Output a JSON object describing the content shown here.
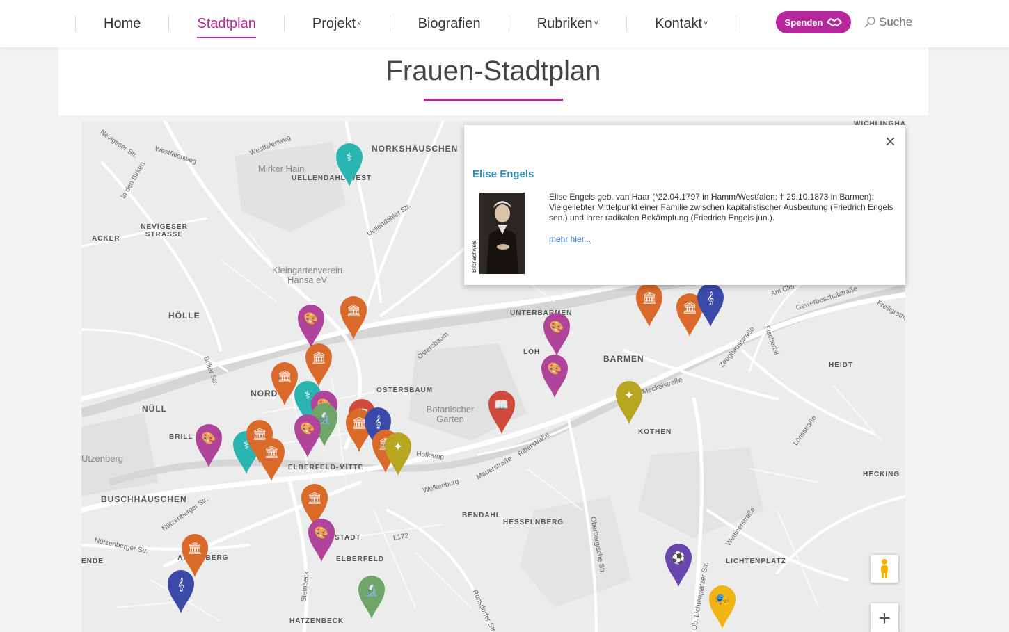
{
  "nav": {
    "items": [
      {
        "label": "Home",
        "active": false,
        "dropdown": false
      },
      {
        "label": "Stadtplan",
        "active": true,
        "dropdown": false
      },
      {
        "label": "Projekt",
        "active": false,
        "dropdown": true
      },
      {
        "label": "Biografien",
        "active": false,
        "dropdown": false
      },
      {
        "label": "Rubriken",
        "active": false,
        "dropdown": true
      },
      {
        "label": "Kontakt",
        "active": false,
        "dropdown": true
      }
    ],
    "donate_label": "Spenden",
    "search_label": "Suche"
  },
  "page": {
    "title": "Frauen-Stadtplan"
  },
  "map": {
    "place_labels": [
      "NORKSHÄUSCHEN",
      "UELLENDAHL-WEST",
      "Mirker Hain",
      "NEVIGESER STRASSE",
      "ACKER",
      "Kleingartenverein Hansa eV",
      "HÖLLE",
      "NÜLL",
      "BRILL",
      "NORD",
      "OSTERSBAUM",
      "Botanischer Garten",
      "UNTERBARMEN",
      "LOH",
      "BARMEN",
      "HEIDT",
      "KOTHEN",
      "BUSCHHÄUSCHEN",
      "ELBERFELD-MITTE",
      "STADT",
      "ELBERFELD",
      "BENDAHL",
      "HESSELNBERG",
      "LICHTENPLATZ",
      "HECKING",
      "WICHLINGHAU",
      "HATZENBECK",
      "ENDE",
      "Utzenberg",
      "ARRENBERG"
    ],
    "street_labels": [
      "Nevigeser Str.",
      "Westfalenweg",
      "Uellendahler Str.",
      "Briller Str.",
      "Hofkamp",
      "Wolkenburg",
      "Mauerstraße",
      "Ritterstraße",
      "Meckelstraße",
      "Zeughausstraße",
      "Fischertal",
      "Lönsstraße",
      "Nützenberger Str.",
      "Steinbeck",
      "L172",
      "Oberbergische Str.",
      "Wettinerstraße",
      "Ob. Lichtenplatzer Str.",
      "Am Clef",
      "Gewerbeschulstraße",
      "Freiligrathstr.",
      "Ronsdorfer Str.",
      "Ostersbaum",
      "In den Birken"
    ],
    "pins": [
      {
        "category": "medicine",
        "color": "#2ab5b3",
        "icon": "stethoscope-icon"
      },
      {
        "category": "art",
        "color": "#b0449a",
        "icon": "palette-icon"
      },
      {
        "category": "history",
        "color": "#d96a2a",
        "icon": "museum-icon"
      },
      {
        "category": "history",
        "color": "#d96a2a",
        "icon": "museum-icon"
      },
      {
        "category": "history",
        "color": "#d96a2a",
        "icon": "museum-icon"
      },
      {
        "category": "medicine",
        "color": "#2ab5b3",
        "icon": "stethoscope-icon"
      },
      {
        "category": "art",
        "color": "#b0449a",
        "icon": "palette-icon"
      },
      {
        "category": "science",
        "color": "#6ea66a",
        "icon": "microscope-icon"
      },
      {
        "category": "art",
        "color": "#b0449a",
        "icon": "palette-icon"
      },
      {
        "category": "literature",
        "color": "#cf4a3a",
        "icon": "book-icon"
      },
      {
        "category": "history",
        "color": "#d96a2a",
        "icon": "museum-icon"
      },
      {
        "category": "music",
        "color": "#3b4aa8",
        "icon": "treble-clef-icon"
      },
      {
        "category": "history",
        "color": "#d96a2a",
        "icon": "museum-icon"
      },
      {
        "category": "sport",
        "color": "#b7a620",
        "icon": "dancer-icon"
      },
      {
        "category": "art",
        "color": "#b0449a",
        "icon": "palette-icon"
      },
      {
        "category": "medicine",
        "color": "#2ab5b3",
        "icon": "stethoscope-icon"
      },
      {
        "category": "history",
        "color": "#d96a2a",
        "icon": "museum-icon"
      },
      {
        "category": "history",
        "color": "#d96a2a",
        "icon": "museum-icon"
      },
      {
        "category": "history",
        "color": "#d96a2a",
        "icon": "museum-icon"
      },
      {
        "category": "art",
        "color": "#b0449a",
        "icon": "palette-icon"
      },
      {
        "category": "history",
        "color": "#d96a2a",
        "icon": "museum-icon"
      },
      {
        "category": "music",
        "color": "#3b4aa8",
        "icon": "treble-clef-icon"
      },
      {
        "category": "science",
        "color": "#6ea66a",
        "icon": "microscope-icon"
      },
      {
        "category": "art",
        "color": "#b0449a",
        "icon": "palette-icon"
      },
      {
        "category": "art",
        "color": "#b0449a",
        "icon": "palette-icon"
      },
      {
        "category": "literature",
        "color": "#cf4a3a",
        "icon": "book-icon"
      },
      {
        "category": "sport",
        "color": "#b7a620",
        "icon": "dancer-icon"
      },
      {
        "category": "history",
        "color": "#d96a2a",
        "icon": "museum-icon"
      },
      {
        "category": "history",
        "color": "#d96a2a",
        "icon": "museum-icon"
      },
      {
        "category": "music",
        "color": "#3b4aa8",
        "icon": "treble-clef-icon"
      },
      {
        "category": "sport",
        "color": "#6a45b0",
        "icon": "football-icon"
      },
      {
        "category": "theatre",
        "color": "#f0b414",
        "icon": "theatre-masks-icon"
      }
    ],
    "zoom_in_label": "+"
  },
  "info_window": {
    "name": "Elise Engels",
    "image_credit": "Bildnachweis",
    "text": "Elise Engels geb. van Haar (*22.04.1797 in Hamm/Westfalen; † 29.10.1873 in Barmen): Vielgeliebter Mittelpunkt einer Familie zwischen kapitalistischer Ausbeutung (Friedrich Engels sen.) und ihrer radikalen Bekämpfung (Friedrich Engels jun.).",
    "more_label": "mehr hier...",
    "close_label": "×"
  },
  "colors": {
    "accent": "#b5279a",
    "link": "#2e8bb8"
  }
}
